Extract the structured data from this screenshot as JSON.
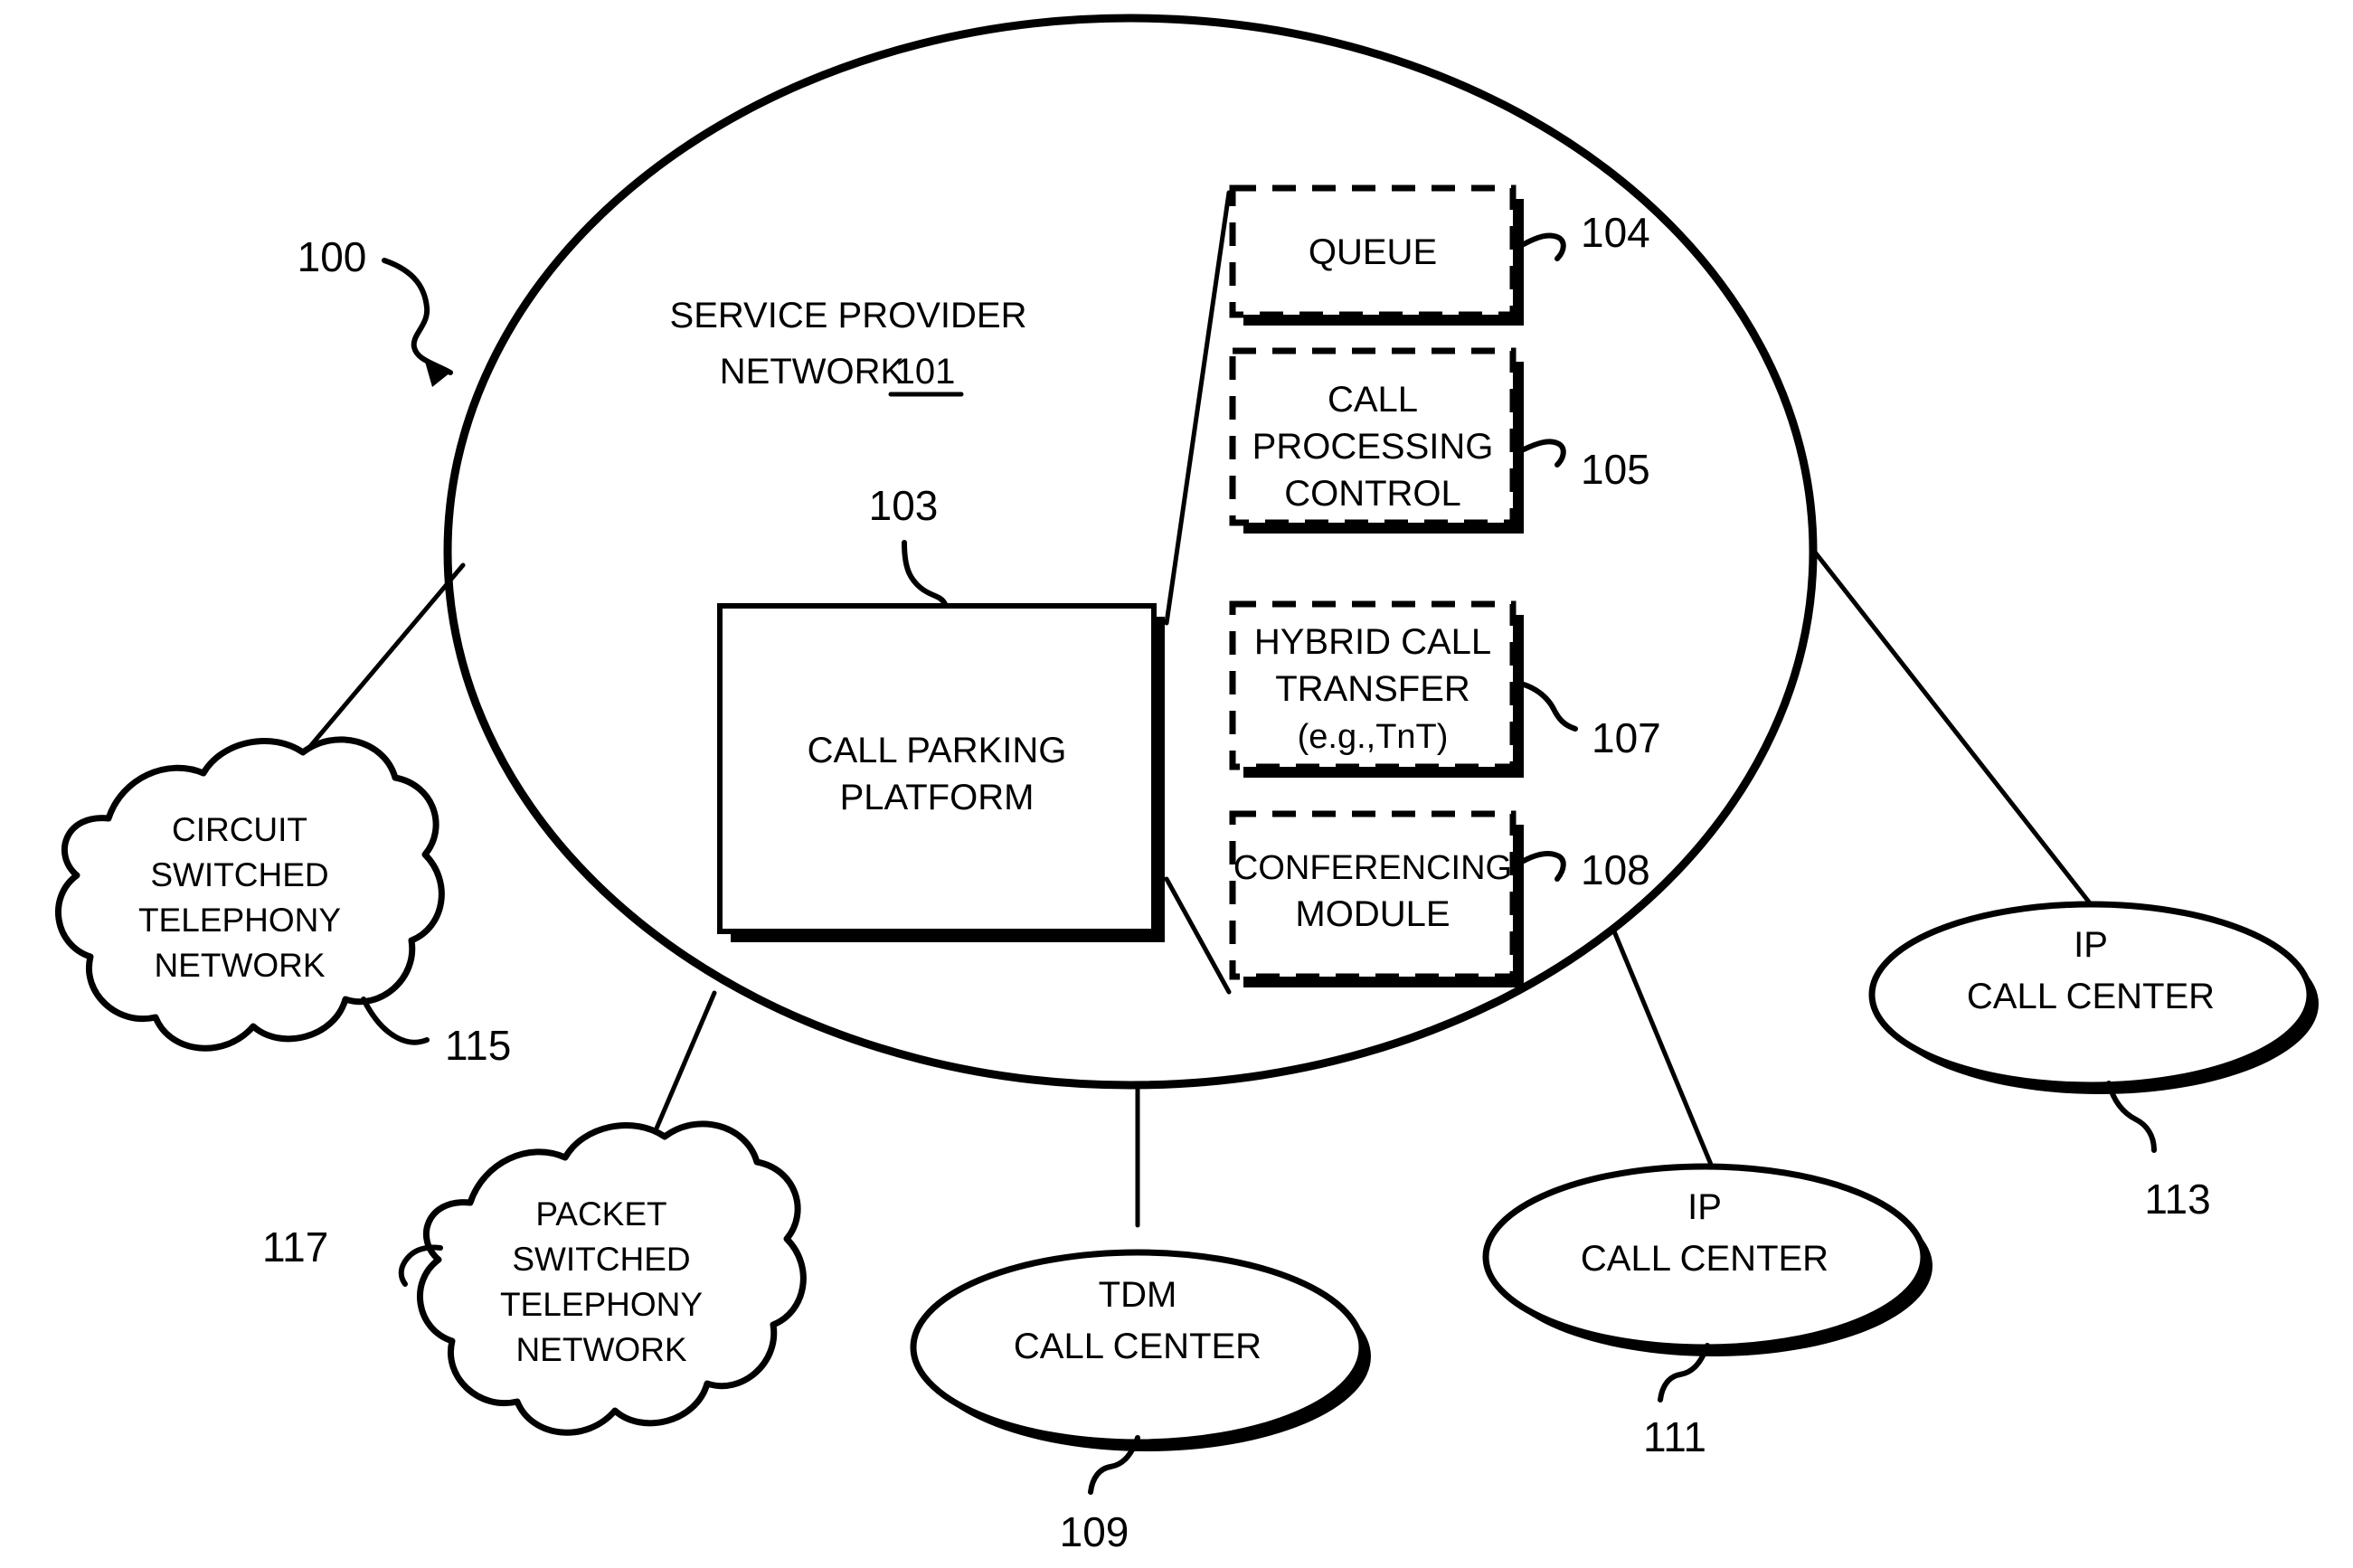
{
  "figure": {
    "figure_ref": "100",
    "network": {
      "title_line1": "SERVICE PROVIDER",
      "title_line2": "NETWORK",
      "title_ref": "101"
    },
    "platform": {
      "label_line1": "CALL PARKING",
      "label_line2": "PLATFORM",
      "ref": "103"
    },
    "modules": [
      {
        "ref": "104",
        "lines": [
          "QUEUE"
        ]
      },
      {
        "ref": "105",
        "lines": [
          "CALL",
          "PROCESSING",
          "CONTROL"
        ]
      },
      {
        "ref": "107",
        "lines": [
          "HYBRID CALL",
          "TRANSFER",
          "(e.g.,TnT)"
        ]
      },
      {
        "ref": "108",
        "lines": [
          "CONFERENCING",
          "MODULE"
        ]
      }
    ],
    "clouds": [
      {
        "ref": "115",
        "lines": [
          "CIRCUIT",
          "SWITCHED",
          "TELEPHONY",
          "NETWORK"
        ]
      },
      {
        "ref": "117",
        "lines": [
          "PACKET",
          "SWITCHED",
          "TELEPHONY",
          "NETWORK"
        ]
      }
    ],
    "call_centers": [
      {
        "ref": "109",
        "line1": "TDM",
        "line2": "CALL CENTER"
      },
      {
        "ref": "111",
        "line1": "IP",
        "line2": "CALL CENTER"
      },
      {
        "ref": "113",
        "line1": "IP",
        "line2": "CALL CENTER"
      }
    ],
    "colors": {
      "ink": "#000000",
      "paper": "#ffffff"
    }
  }
}
